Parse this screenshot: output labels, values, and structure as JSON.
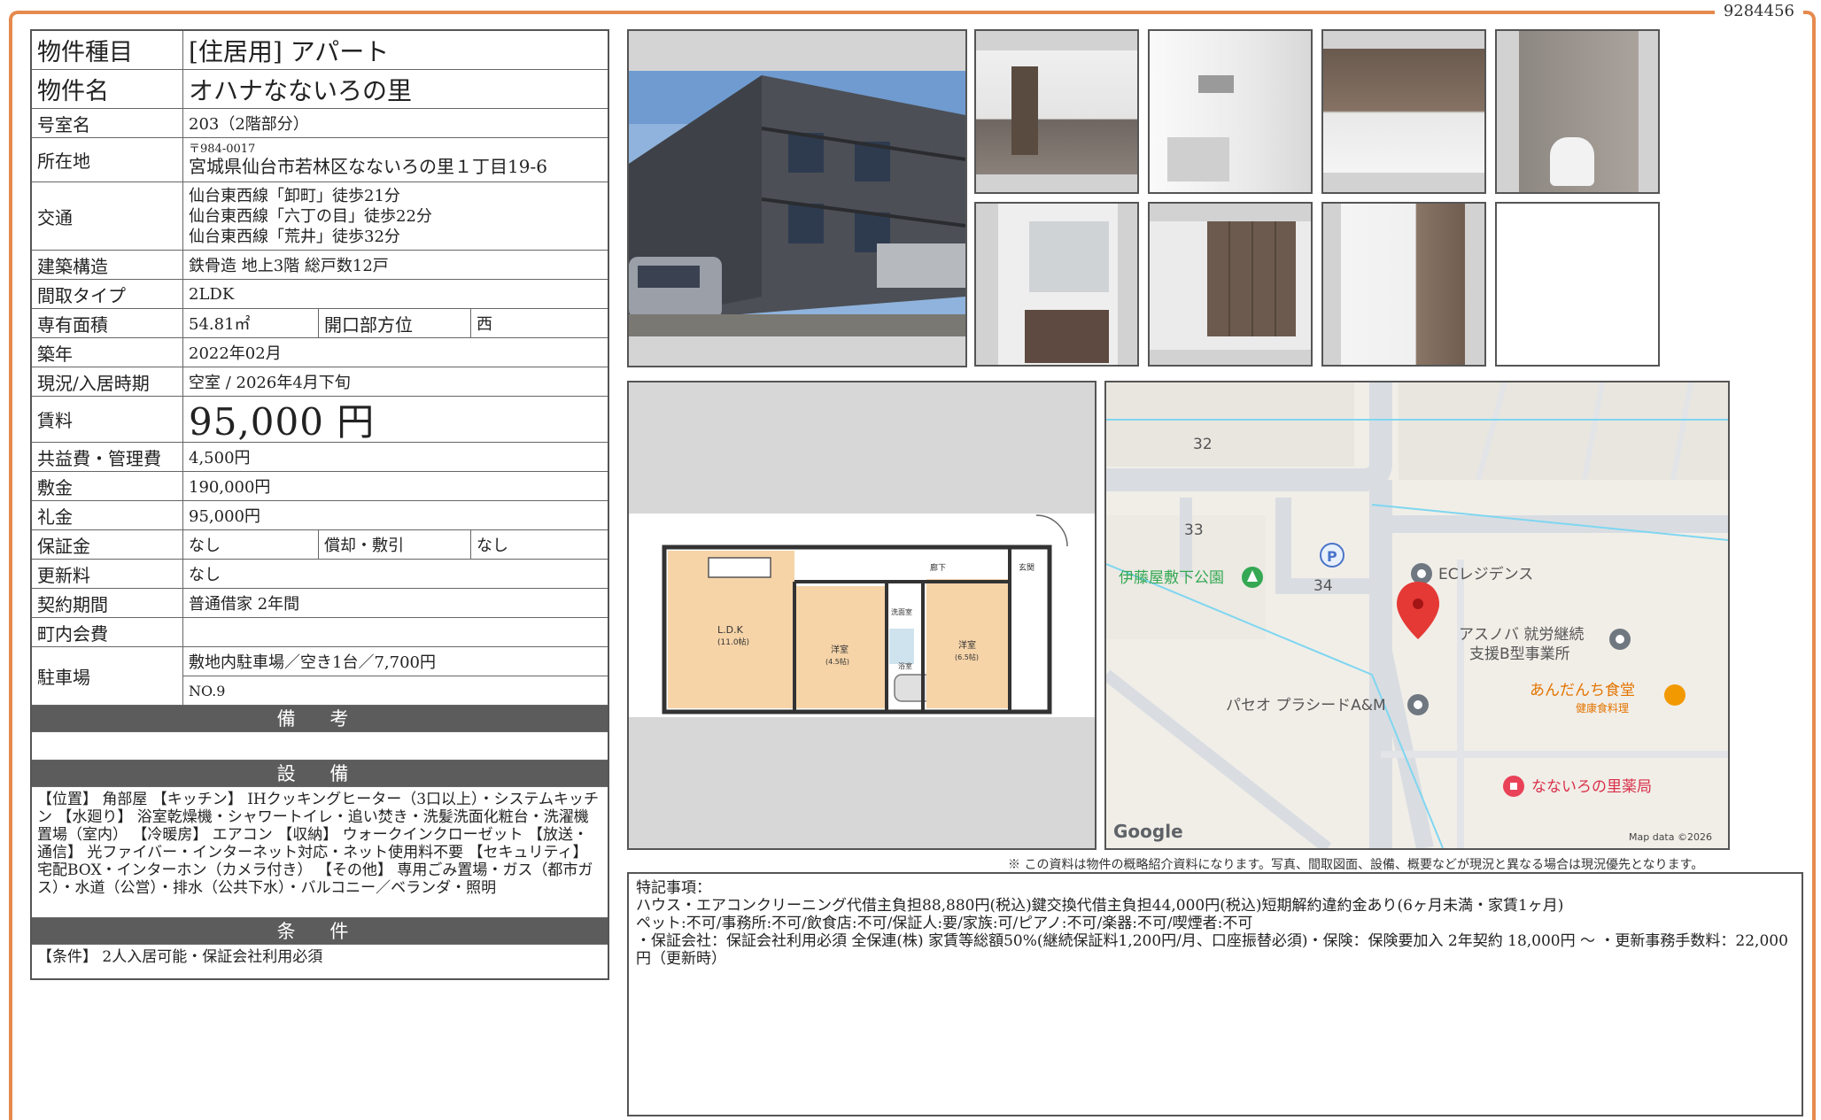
{
  "doc_id": "9284456",
  "property": {
    "type_label": "物件種目",
    "type_value": "[住居用]  アパート",
    "name_label": "物件名",
    "name_value": "オハナなないろの里",
    "room_label": "号室名",
    "room_value": "203（2階部分）",
    "address_label": "所在地",
    "zip": "〒984-0017",
    "address": "宮城県仙台市若林区なないろの里１丁目19-6",
    "transport_label": "交通",
    "transport": [
      "仙台東西線「卸町」徒歩21分",
      "仙台東西線「六丁の目」徒歩22分",
      "仙台東西線「荒井」徒歩32分"
    ],
    "structure_label": "建築構造",
    "structure_value": "鉄骨造  地上3階  総戸数12戸",
    "layout_label": "間取タイプ",
    "layout_value": "2LDK",
    "area_label": "専有面積",
    "area_value": "54.81㎡",
    "direction_label": "開口部方位",
    "direction_value": "西",
    "built_label": "築年",
    "built_value": "2022年02月",
    "status_label": "現況/入居時期",
    "status_value": "空室  /  2026年4月下旬",
    "rent_label": "賃料",
    "rent_value": "95,000 円",
    "fee_label": "共益費・管理費",
    "fee_value": "4,500円",
    "deposit_label": "敷金",
    "deposit_value": "190,000円",
    "key_label": "礼金",
    "key_value": "95,000円",
    "guarantee_label": "保証金",
    "guarantee_value": "なし",
    "amort_label": "償却・敷引",
    "amort_value": "なし",
    "renew_label": "更新料",
    "renew_value": "なし",
    "contract_label": "契約期間",
    "contract_value": "普通借家  2年間",
    "community_label": "町内会費",
    "community_value": "",
    "parking_label": "駐車場",
    "parking_value": "敷地内駐車場／空き1台／7,700円",
    "parking_no": "NO.9"
  },
  "sections": {
    "remarks_title": "備 考",
    "remarks_text": "",
    "equipment_title": "設 備",
    "equipment_text": "【位置】 角部屋 【キッチン】 IHクッキングヒーター（3口以上）・システムキッチン 【水廻り】 浴室乾燥機・シャワートイレ・追い焚き・洗髪洗面化粧台・洗濯機置場（室内） 【冷暖房】 エアコン 【収納】 ウォークインクローゼット 【放送・通信】 光ファイバー・インターネット対応・ネット使用料不要 【セキュリティ】 宅配BOX・インターホン（カメラ付き） 【その他】 専用ごみ置場・ガス（都市ガス）・水道（公営）・排水（公共下水）・バルコニー／ベランダ・照明",
    "conditions_title": "条 件",
    "conditions_text": "【条件】 2人入居可能・保証会社利用必須"
  },
  "floorplan": {
    "ldk": "L.D.K",
    "ldk_size": "(11.0帖)",
    "room1": "洋室",
    "room1_size": "(4.5帖)",
    "room2": "洋室",
    "room2_size": "(6.5帖)",
    "hall": "廊下",
    "entrance": "玄関",
    "washroom": "洗面室",
    "bath": "浴室"
  },
  "map": {
    "labels": {
      "n32": "32",
      "n33": "33",
      "n34": "34",
      "park": "伊藤屋敷下公園",
      "ec": "ECレジデンス",
      "asunoba1": "アスノバ 就労継続",
      "asunoba2": "支援B型事業所",
      "anda1": "あんだんち食堂",
      "anda2": "健康食料理",
      "paseo": "パセオ プラシードA&M",
      "pharmacy": "なないろの里薬局",
      "google": "Google",
      "mapdata": "Map data ©2026",
      "parking_p": "P"
    },
    "colors": {
      "road": "#d9dde2",
      "bg": "#f2efe9",
      "water": "#7fd6f0",
      "pin": "#e53935",
      "park": "#34a853",
      "food": "#f29900",
      "pharmacy": "#e94258"
    }
  },
  "notice": "※ この資料は物件の概略紹介資料になります。写真、間取図面、設備、概要などが現況と異なる場合は現況優先となります。",
  "special": {
    "title": "特記事項：",
    "lines": [
      "ハウス・エアコンクリーニング代借主負担88,880円(税込)鍵交換代借主負担44,000円(税込)短期解約違約金あり(6ヶ月未満・家賃1ヶ月)",
      "ペット:不可/事務所:不可/飲食店:不可/保証人:要/家族:可/ピアノ:不可/楽器:不可/喫煙者:不可",
      "・保証会社：保証会社利用必須 全保連(株) 家賃等総額50%(継続保証料1,200円/月、口座振替必須)・保険：保険要加入 2年契約 18,000円 〜 ・更新事務手数料：22,000円（更新時）"
    ]
  }
}
